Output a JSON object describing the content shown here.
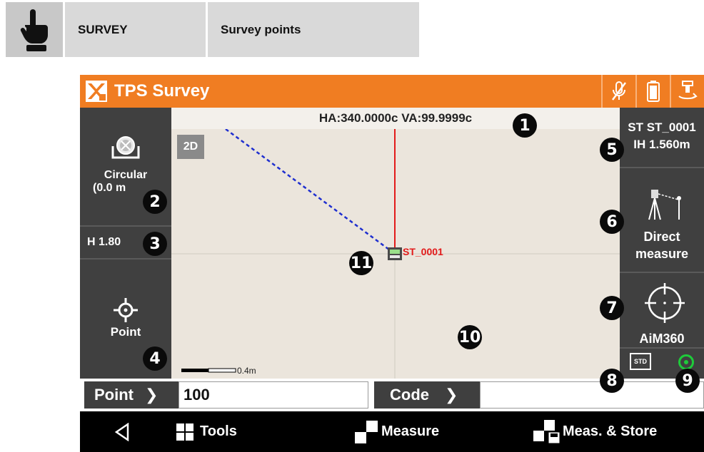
{
  "header": {
    "icon": "hand-pointer-icon",
    "section": "SURVEY",
    "topic": "Survey points"
  },
  "app": {
    "title": "TPS Survey",
    "accent_color": "#f07d22",
    "status_icons": [
      "mic-off-icon",
      "battery-icon",
      "instrument-icon"
    ]
  },
  "map": {
    "hv_readout": "HA:340.0000c  VA:99.9999c",
    "view_mode": "2D",
    "station_label": "ST_0001",
    "scale_label": "0.4m"
  },
  "left_panel": {
    "prism_icon": "prism-icon",
    "prism_type": "Circular",
    "prism_const": "(0.0 m",
    "target_height": "H 1.80",
    "point_icon": "crosshair-icon",
    "point_label": "Point"
  },
  "right_panel": {
    "station": "ST ST_0001",
    "instrument_height": "IH 1.560m",
    "measure_mode_line1": "Direct",
    "measure_mode_line2": "measure",
    "aim_mode": "AiM360",
    "std_label": "STD"
  },
  "input_row": {
    "point_label": "Point",
    "point_value": "100",
    "code_label": "Code",
    "code_value": ""
  },
  "navbar": {
    "tools": "Tools",
    "measure": "Measure",
    "meas_store": "Meas. & Store"
  },
  "callouts": [
    "1",
    "2",
    "3",
    "4",
    "5",
    "6",
    "7",
    "8",
    "9",
    "10",
    "11"
  ]
}
